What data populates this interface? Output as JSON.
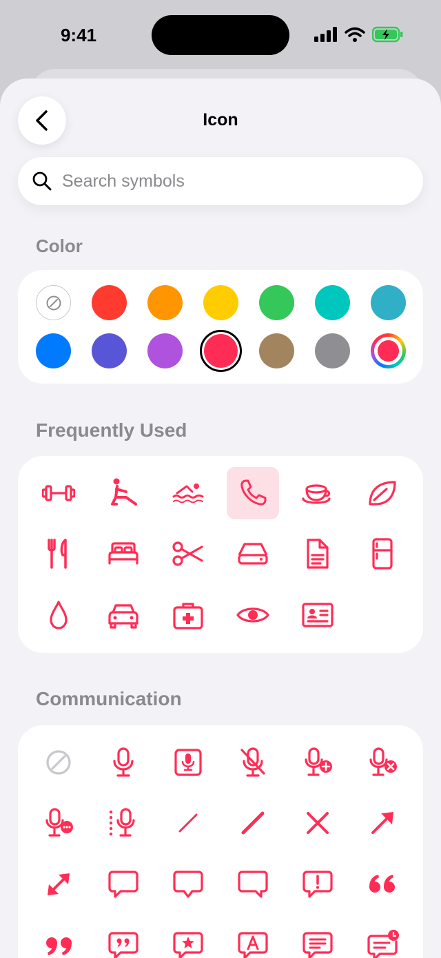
{
  "status": {
    "time": "9:41"
  },
  "header": {
    "title": "Icon"
  },
  "search": {
    "placeholder": "Search symbols"
  },
  "sections": {
    "color": "Color",
    "frequent": "Frequently Used",
    "communication": "Communication"
  },
  "colors": {
    "row1": [
      "none",
      "#ff3b30",
      "#ff9500",
      "#ffcc00",
      "#34c759",
      "#00c7be",
      "#30b0c7"
    ],
    "row2": [
      "#007aff",
      "#5856d6",
      "#af52de",
      "#ff2d55",
      "#a2845e",
      "#8e8e93",
      "custom"
    ],
    "selected": "#ff2d55",
    "accent": "#ff2d55"
  },
  "frequent_icons": [
    "dumbbell-icon",
    "figure-stretch-icon",
    "figure-swim-icon",
    "phone-icon",
    "cup-saucer-icon",
    "leaf-icon",
    "fork-knife-icon",
    "bed-icon",
    "scissors-icon",
    "drive-icon",
    "document-icon",
    "refrigerator-icon",
    "drop-icon",
    "car-icon",
    "first-aid-kit-icon",
    "eye-icon",
    "id-card-icon"
  ],
  "selected_icon": "phone-icon",
  "communication_icons": [
    "none-icon",
    "mic-icon",
    "mic-square-icon",
    "mic-slash-icon",
    "mic-plus-icon",
    "mic-xmark-icon",
    "mic-ellipsis-icon",
    "mic-waveform-icon",
    "line-diagonal-icon",
    "line-diagonal-bold-icon",
    "xmark-lines-icon",
    "arrow-up-right-icon",
    "arrow-diagonal-double-icon",
    "bubble-left-icon",
    "bubble-middle-icon",
    "bubble-right-icon",
    "bubble-exclamation-icon",
    "quote-open-icon",
    "quote-close-icon",
    "bubble-quote-icon",
    "bubble-star-icon",
    "bubble-character-icon",
    "bubble-text-icon",
    "bubble-badge-icon"
  ]
}
